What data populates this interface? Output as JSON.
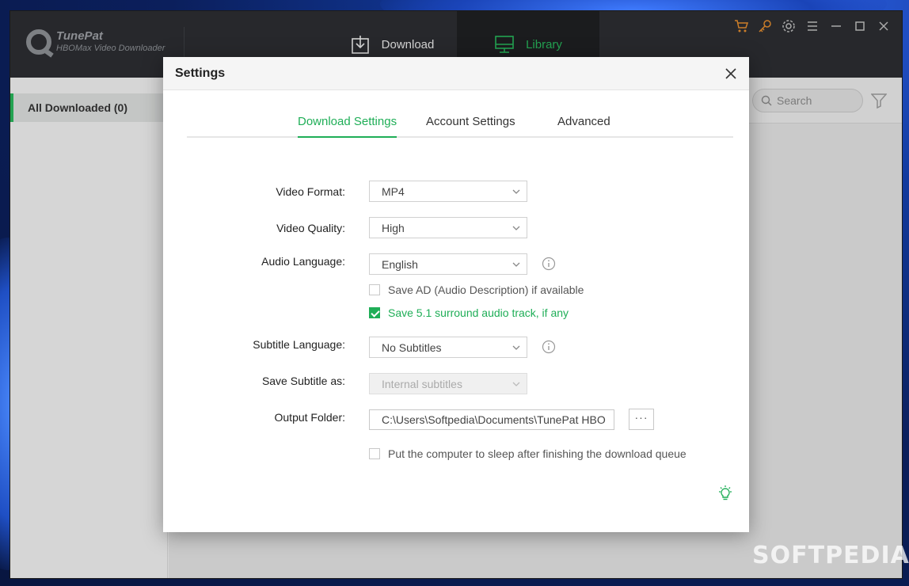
{
  "app": {
    "name": "TunePat",
    "subtitle": "HBOMax Video Downloader",
    "nav": {
      "download_label": "Download",
      "library_label": "Library"
    },
    "sidebar": {
      "items": [
        {
          "label": "All Downloaded (0)"
        }
      ]
    },
    "search": {
      "placeholder": "Search"
    }
  },
  "dialog": {
    "title": "Settings",
    "tabs": [
      {
        "label": "Download Settings",
        "active": true
      },
      {
        "label": "Account Settings",
        "active": false
      },
      {
        "label": "Advanced",
        "active": false
      }
    ],
    "fields": {
      "video_format": {
        "label": "Video Format:",
        "value": "MP4"
      },
      "video_quality": {
        "label": "Video Quality:",
        "value": "High"
      },
      "audio_language": {
        "label": "Audio Language:",
        "value": "English"
      },
      "save_ad": {
        "label": "Save AD (Audio Description) if available",
        "checked": false
      },
      "save_51": {
        "label": "Save 5.1 surround audio track, if any",
        "checked": true
      },
      "subtitle_language": {
        "label": "Subtitle Language:",
        "value": "No Subtitles"
      },
      "save_subtitle_as": {
        "label": "Save Subtitle as:",
        "value": "Internal subtitles",
        "disabled": true
      },
      "output_folder": {
        "label": "Output Folder:",
        "value": "C:\\Users\\Softpedia\\Documents\\TunePat HBO",
        "browse_label": "···"
      },
      "sleep": {
        "label": "Put the computer to sleep after finishing the download queue",
        "checked": false
      }
    }
  },
  "watermark": "SOFTPEDIA",
  "colors": {
    "accent": "#1fae57",
    "titlebar": "#2b2d31",
    "toolbar_icons": "#e08a2e"
  }
}
